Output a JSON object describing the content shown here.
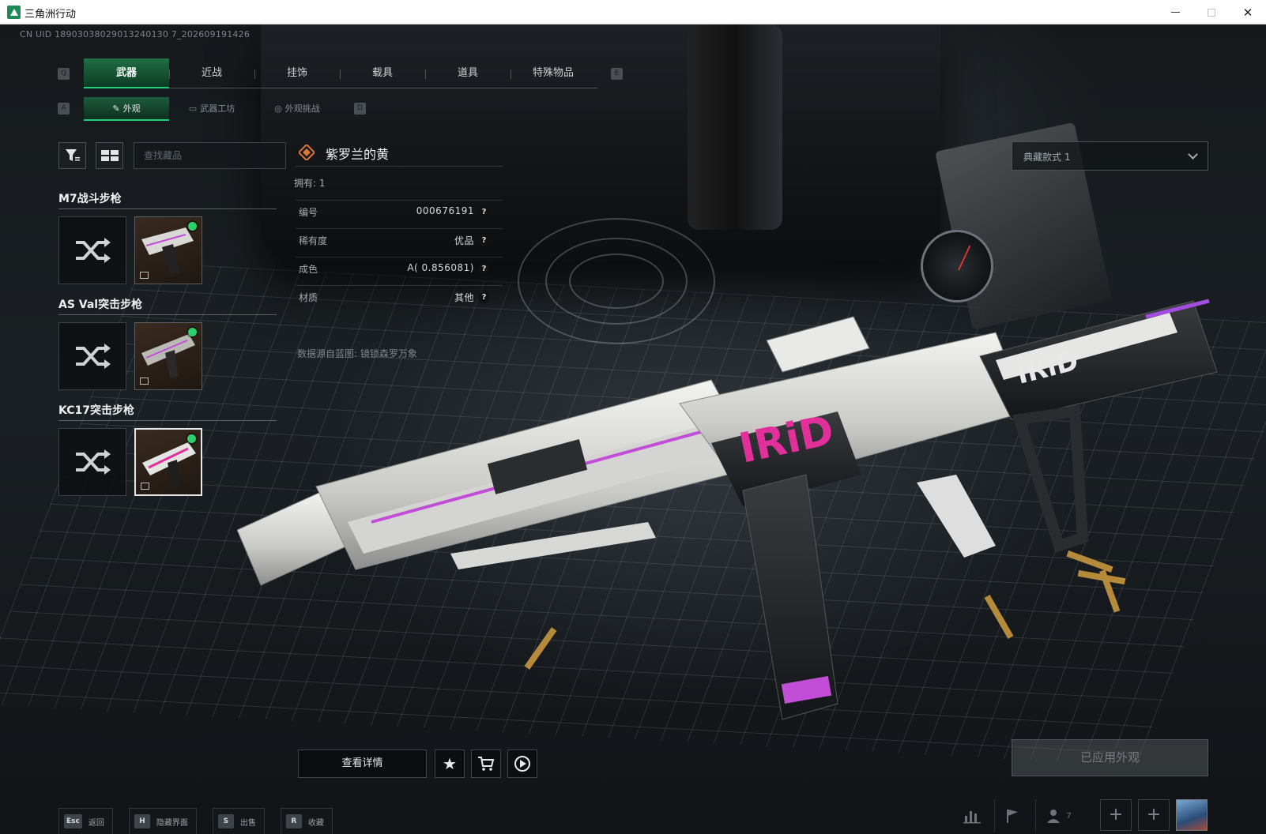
{
  "window": {
    "title": "三角洲行动"
  },
  "uid_text": "CN UID 18903038029013240130 7_202609191426",
  "category_tabs": [
    {
      "label": "武器",
      "active": true
    },
    {
      "label": "近战",
      "active": false
    },
    {
      "label": "挂饰",
      "active": false
    },
    {
      "label": "载具",
      "active": false
    },
    {
      "label": "道具",
      "active": false
    },
    {
      "label": "特殊物品",
      "active": false
    }
  ],
  "tab_keys": {
    "prev": "Q",
    "next": "E",
    "sub_prev": "A",
    "sub_next": "D"
  },
  "sub_tabs": [
    {
      "label": "外观",
      "active": true
    },
    {
      "label": "武器工坊",
      "active": false
    },
    {
      "label": "外观挑战",
      "active": false
    }
  ],
  "search": {
    "placeholder": "查找藏品",
    "value": ""
  },
  "weapon_groups": [
    {
      "title": "M7战斗步枪",
      "equipped": true,
      "selected": false
    },
    {
      "title": "AS Val突击步枪",
      "equipped": true,
      "selected": false
    },
    {
      "title": "KC17突击步枪",
      "equipped": true,
      "selected": true
    }
  ],
  "detail": {
    "skin_name": "紫罗兰的黄",
    "owned": "拥有: 1",
    "attributes": [
      {
        "label": "编号",
        "value": "000676191"
      },
      {
        "label": "稀有度",
        "value": "优品"
      },
      {
        "label": "成色",
        "value": "A( 0.856081)"
      },
      {
        "label": "材质",
        "value": "其他"
      }
    ],
    "source": "数据源自蓝图: 镜锁森罗万象"
  },
  "variant_select": {
    "value": "典藏款式 1"
  },
  "actions": {
    "view_details": "查看详情",
    "favorite_icon": "star-icon",
    "market_icon": "cart-icon",
    "preview_icon": "play-icon",
    "applied": "已应用外观"
  },
  "hotkeys": [
    {
      "key": "Esc",
      "label": "返回"
    },
    {
      "key": "H",
      "label": "隐藏界面"
    },
    {
      "key": "S",
      "label": "出售"
    },
    {
      "key": "R",
      "label": "收藏"
    }
  ],
  "status_bar": {
    "friends_count": "7"
  },
  "colors": {
    "accent": "#1fd07a",
    "tab_active": "#1f6e44",
    "equipped_dot": "#2bd06a",
    "skin_pink": "#e2309a",
    "skin_purple": "#a24ee0"
  }
}
